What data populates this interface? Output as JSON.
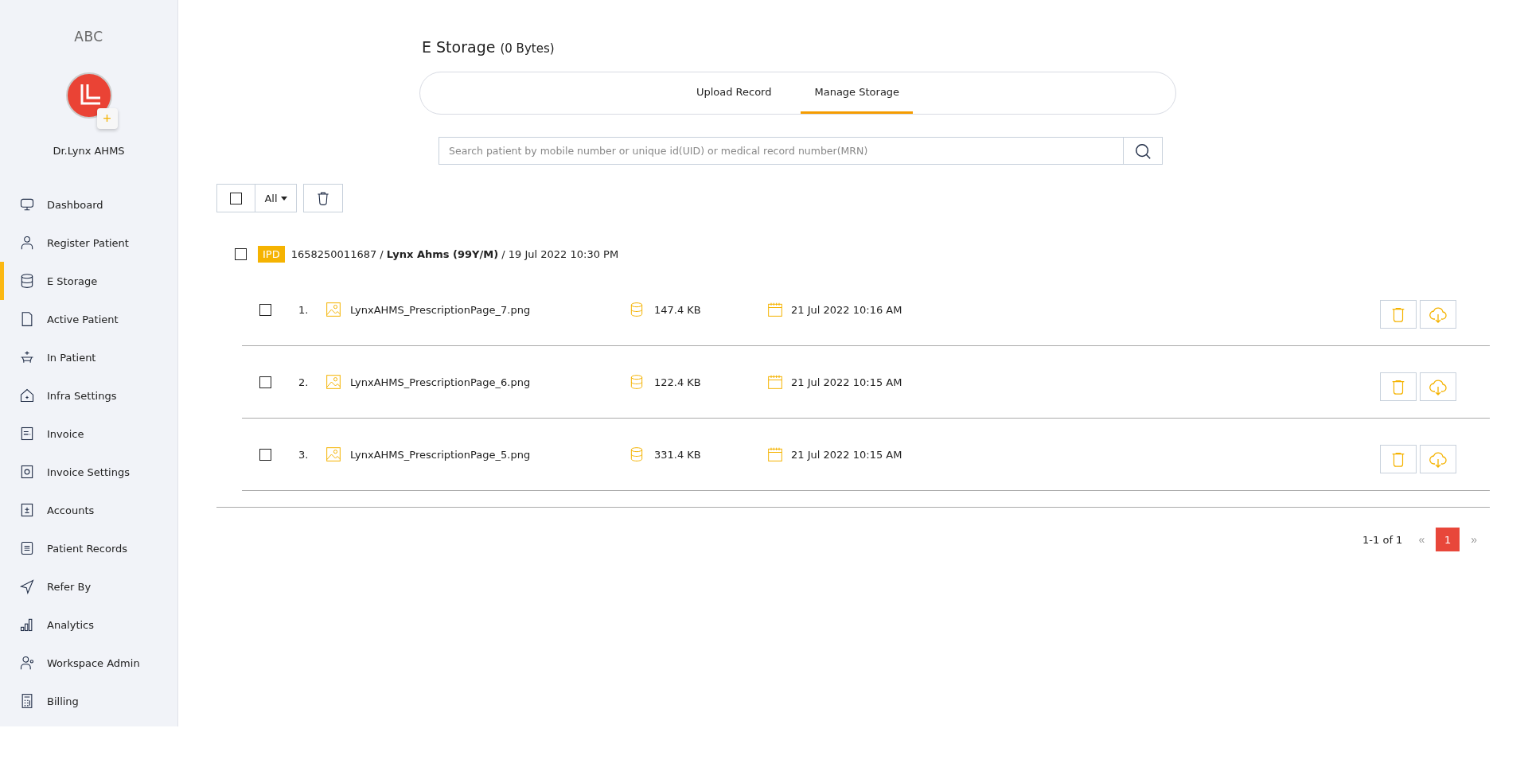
{
  "sidebar": {
    "brand": "ABC",
    "user_name": "Dr.Lynx AHMS",
    "avatar_add": "+",
    "items": [
      {
        "label": "Dashboard",
        "selected": false
      },
      {
        "label": "Register Patient",
        "selected": false
      },
      {
        "label": "E Storage",
        "selected": true
      },
      {
        "label": "Active Patient",
        "selected": false
      },
      {
        "label": "In Patient",
        "selected": false
      },
      {
        "label": "Infra Settings",
        "selected": false
      },
      {
        "label": "Invoice",
        "selected": false
      },
      {
        "label": "Invoice Settings",
        "selected": false
      },
      {
        "label": "Accounts",
        "selected": false
      },
      {
        "label": "Patient Records",
        "selected": false
      },
      {
        "label": "Refer By",
        "selected": false
      },
      {
        "label": "Analytics",
        "selected": false
      },
      {
        "label": "Workspace Admin",
        "selected": false
      },
      {
        "label": "Billing",
        "selected": false
      }
    ]
  },
  "page": {
    "title": "E Storage",
    "size": "(0 Bytes)"
  },
  "tabs": [
    {
      "label": "Upload Record",
      "selected": false
    },
    {
      "label": "Manage Storage",
      "selected": true
    }
  ],
  "search": {
    "placeholder": "Search patient by mobile number or unique id(UID) or medical record number(MRN)"
  },
  "toolbar": {
    "select_all_checked": false,
    "filter": "All"
  },
  "groups": [
    {
      "checked": false,
      "badge": "IPD",
      "info": "1658250011687 / **Lynx Ahms (99Y/M)** / 19 Jul 2022 10:30 PM",
      "files": [
        {
          "checked": false,
          "index": "1.",
          "name": "LynxAHMS_PrescriptionPage_7.png",
          "size": "147.4 KB",
          "date": "21 Jul 2022 10:16 AM"
        },
        {
          "checked": false,
          "index": "2.",
          "name": "LynxAHMS_PrescriptionPage_6.png",
          "size": "122.4 KB",
          "date": "21 Jul 2022 10:15 AM"
        },
        {
          "checked": false,
          "index": "3.",
          "name": "LynxAHMS_PrescriptionPage_5.png",
          "size": "331.4 KB",
          "date": "21 Jul 2022 10:15 AM"
        }
      ]
    }
  ],
  "pagination": {
    "range": "1-1 of 1",
    "prev": "«",
    "next": "»",
    "pages": [
      {
        "label": "1",
        "selected": true
      }
    ]
  }
}
